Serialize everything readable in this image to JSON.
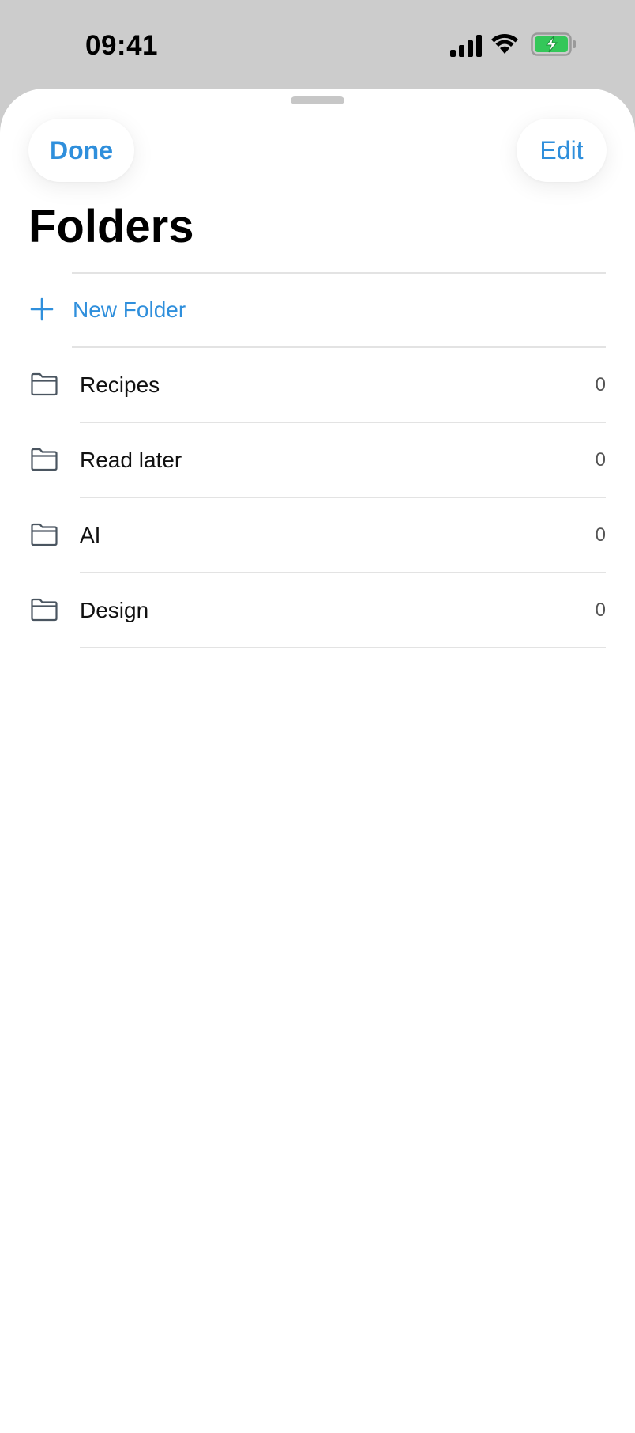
{
  "status_bar": {
    "time": "09:41",
    "icons": [
      "signal-icon",
      "wifi-icon",
      "battery-charging-icon"
    ]
  },
  "header": {
    "done_label": "Done",
    "edit_label": "Edit",
    "title": "Folders"
  },
  "new_folder": {
    "label": "New Folder",
    "icon": "plus-icon"
  },
  "folders": [
    {
      "name": "Recipes",
      "count": "0",
      "icon": "folder-icon"
    },
    {
      "name": "Read later",
      "count": "0",
      "icon": "folder-icon"
    },
    {
      "name": "AI",
      "count": "0",
      "icon": "folder-icon"
    },
    {
      "name": "Design",
      "count": "0",
      "icon": "folder-icon"
    }
  ],
  "colors": {
    "accent": "#2f8fdc",
    "backdrop": "#cccccc",
    "sheet": "#ffffff",
    "battery_fill": "#34c759"
  }
}
